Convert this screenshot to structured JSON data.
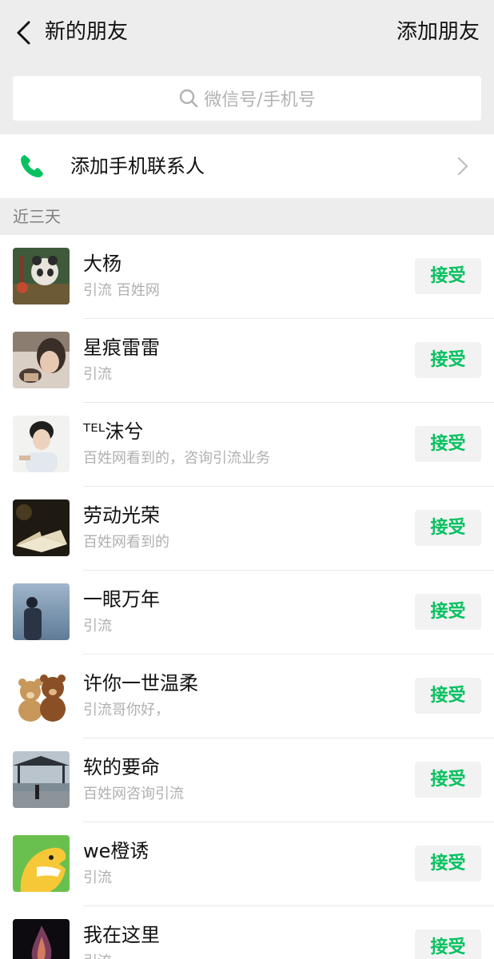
{
  "header": {
    "title": "新的朋友",
    "action_label": "添加朋友"
  },
  "search": {
    "placeholder": "微信号/手机号"
  },
  "add_phone": {
    "label": "添加手机联系人",
    "icon": "phone-icon"
  },
  "section": {
    "label": "近三天"
  },
  "colors": {
    "accent_green": "#07c160",
    "background": "#ededed",
    "secondary_text": "#b0b0b0"
  },
  "requests": [
    {
      "name": "大杨",
      "message": "引流 百姓网",
      "action": "接受"
    },
    {
      "name": "星痕雷雷",
      "message": "引流",
      "action": "接受"
    },
    {
      "name": "ᵀᴱᴸ沫兮",
      "message": "百姓网看到的，咨询引流业务",
      "action": "接受"
    },
    {
      "name": "劳动光荣",
      "message": "百姓网看到的",
      "action": "接受"
    },
    {
      "name": "一眼万年",
      "message": "引流",
      "action": "接受"
    },
    {
      "name": "许你一世温柔",
      "message": "引流哥你好，",
      "action": "接受"
    },
    {
      "name": "软的要命",
      "message": "百姓网咨询引流",
      "action": "接受"
    },
    {
      "name": "we橙诱",
      "message": "引流",
      "action": "接受"
    },
    {
      "name": "我在这里",
      "message": "引流",
      "action": "接受"
    }
  ]
}
